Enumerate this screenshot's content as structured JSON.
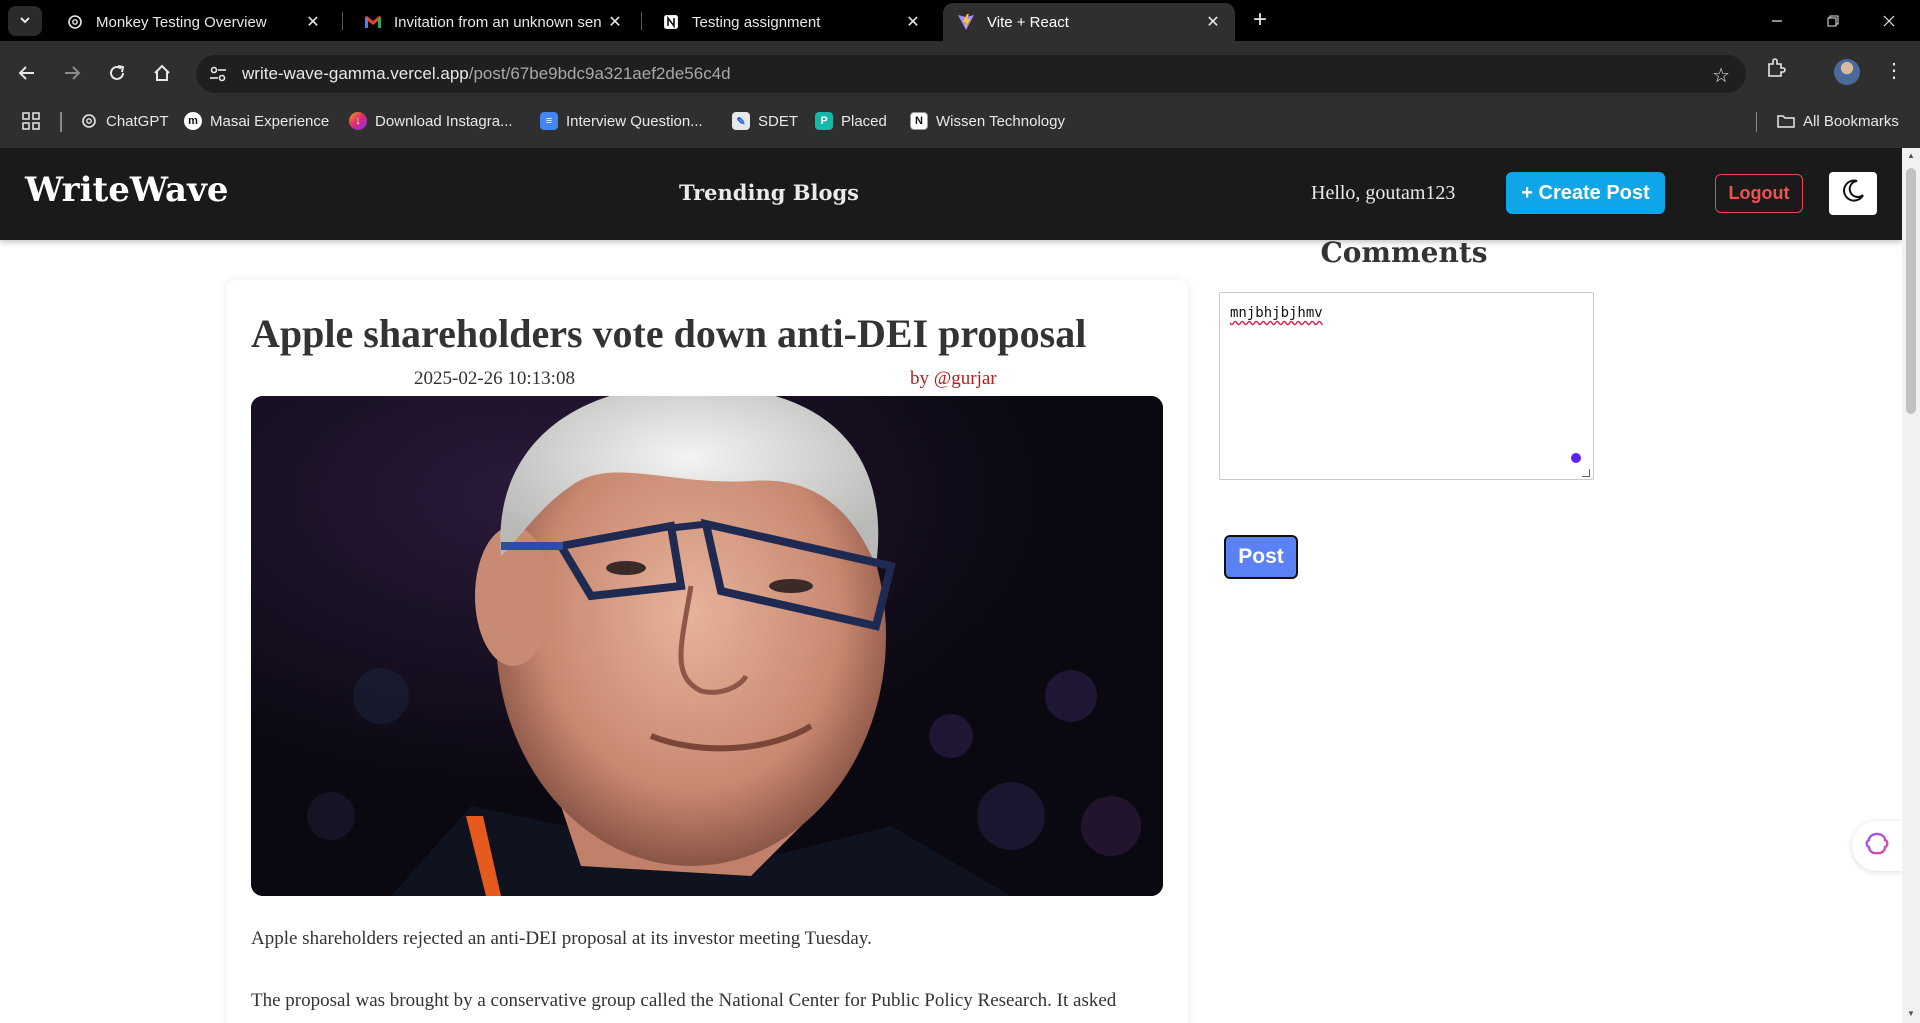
{
  "browser": {
    "tabs": [
      {
        "title": "Monkey Testing Overview",
        "icon": "openai-icon",
        "active": false
      },
      {
        "title": "Invitation from an unknown sen",
        "icon": "gmail-icon",
        "active": false
      },
      {
        "title": "Testing assignment",
        "icon": "notion-icon",
        "active": false
      },
      {
        "title": "Vite + React",
        "icon": "vite-icon",
        "active": true
      }
    ],
    "url_host": "write-wave-gamma.vercel.app",
    "url_path": "/post/67be9bdc9a321aef2de56c4d",
    "bookmarks": [
      {
        "label": "ChatGPT",
        "icon": "openai-icon"
      },
      {
        "label": "Masai Experience",
        "icon": "masai-icon"
      },
      {
        "label": "Download Instagra...",
        "icon": "instagram-icon"
      },
      {
        "label": "Interview Question...",
        "icon": "docs-icon"
      },
      {
        "label": "SDET",
        "icon": "notepad-icon"
      },
      {
        "label": "Placed",
        "icon": "placed-icon"
      },
      {
        "label": "Wissen Technology",
        "icon": "notion-icon"
      }
    ],
    "all_bookmarks": "All Bookmarks"
  },
  "navbar": {
    "brand": "WriteWave",
    "trending": "Trending Blogs",
    "greeting": "Hello, goutam123",
    "create_post": "+ Create Post",
    "logout": "Logout"
  },
  "post": {
    "title": "Apple shareholders vote down anti-DEI proposal",
    "date": "2025-02-26 10:13:08",
    "author": "by @gurjar",
    "paragraphs": [
      "Apple shareholders rejected an anti-DEI proposal at its investor meeting Tuesday.",
      "The proposal was brought by a conservative group called the National Center for Public Policy Research. It asked"
    ]
  },
  "comments": {
    "title": "Comments",
    "input_value": "mnjbhjbjhmv",
    "post_button": "Post"
  },
  "colors": {
    "navbar_bg": "#1a1a1a",
    "create_button": "#0ea5e9",
    "logout": "#f05252",
    "author": "#b91c1c",
    "post_button": "#5b82f5"
  }
}
